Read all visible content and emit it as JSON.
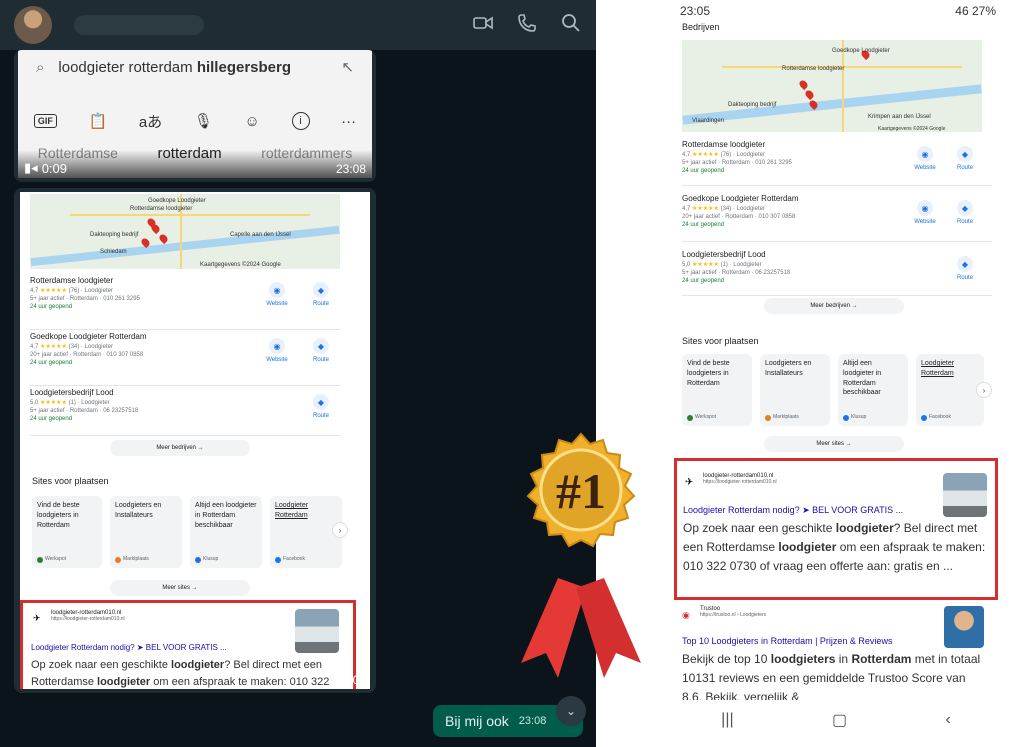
{
  "chat": {
    "video_duration": "0:09",
    "bubble1_time": "23:08",
    "bubble2_time": "23:08",
    "sent_message": "Bij mij ook",
    "sent_time": "23:08",
    "keyboard": {
      "query_prefix": "loodgieter rotterdam ",
      "query_bold": "hillegersberg",
      "suggestions": [
        "Rotterdamse",
        "rotterdam",
        "rotterdammers"
      ],
      "tools": [
        "GIF",
        "clipboard-icon",
        "translate-icon",
        "mic-icon",
        "sticker-icon",
        "info-icon",
        "more-icon"
      ]
    }
  },
  "serp": {
    "status_time": "23:05",
    "status_right": "46 27%",
    "businesses_heading": "Bedrijven",
    "map_labels": [
      "Goedkope Loodgieter",
      "Rotterdamse loodgieter",
      "Dakteoping bedrijf",
      "Schiedam",
      "Vlaardingen",
      "Capelle aan den IJssel",
      "Krimpen aan den IJssel",
      "Schollevaar",
      "Kaartgegevens ©2024 Google",
      "Voorwaarden",
      "Sneltoetsen"
    ],
    "businesses": [
      {
        "name": "Rotterdamse loodgieter",
        "rating": "4,7",
        "stars": "★★★★★",
        "reviews": "(76)",
        "type": "Loodgieter",
        "detail": "5+ jaar actief · Rotterdam · 010 261 3295",
        "hours": "24 uur geopend",
        "website": true
      },
      {
        "name": "Goedkope Loodgieter Rotterdam",
        "rating": "4,7",
        "stars": "★★★★★",
        "reviews": "(34)",
        "type": "Loodgieter",
        "detail": "20+ jaar actief · Rotterdam · 010 307 0858",
        "hours": "24 uur geopend",
        "website": true
      },
      {
        "name": "Loodgietersbedrijf Lood",
        "rating": "5,0",
        "stars": "★★★★★",
        "reviews": "(1)",
        "type": "Loodgieter",
        "detail": "5+ jaar actief · Rotterdam · 06 23257518",
        "hours": "24 uur geopend",
        "website": false
      }
    ],
    "website_label": "Website",
    "route_label": "Route",
    "more_businesses": "Meer bedrijven →",
    "sites_heading": "Sites voor plaatsen",
    "sites": [
      {
        "text": "Vind de beste loodgieters in Rotterdam",
        "source": "Werkspot",
        "color": "#2e7d32",
        "underline": false
      },
      {
        "text": "Loodgieters en Installateurs",
        "source": "Marktplaats",
        "color": "#e67e22",
        "underline": false
      },
      {
        "text": "Altijd een loodgieter in Rotterdam beschikbaar",
        "source": "Klusup",
        "color": "#1a73e8",
        "underline": false
      },
      {
        "text": "Loodgieter Rotterdam",
        "source": "Facebook",
        "color": "#1877f2",
        "underline": true
      }
    ],
    "more_sites": "Meer sites →",
    "top_result": {
      "site": "loodgieter-rotterdam010.nl",
      "url": "https://loodgieter-rotterdam010.nl",
      "title": "Loodgieter Rotterdam nodig? ➤ BEL VOOR GRATIS ...",
      "snippet_a": "Op zoek naar een geschikte ",
      "snippet_b": "loodgieter",
      "snippet_c": "? Bel direct met een Rotterdamse ",
      "snippet_d": "loodgieter",
      "snippet_e": " om een afspraak te maken: 010 322 0730 of vraag een offerte aan: gratis en ..."
    },
    "second_result": {
      "site": "Trustoo",
      "url": "https://trustoo.nl › Loodgieters",
      "title": "Top 10 Loodgieters in Rotterdam | Prijzen & Reviews",
      "snippet_a": "Bekijk de top 10 ",
      "snippet_b": "loodgieters",
      "snippet_c": " in ",
      "snippet_d": "Rotterdam",
      "snippet_e": " met in totaal 10131 reviews en een gemiddelde Trustoo Score van 8.6. Bekijk, vergelijk &"
    }
  },
  "badge": {
    "text": "#1",
    "color_gold": "#e0a526",
    "color_ribbon": "#e53935"
  }
}
